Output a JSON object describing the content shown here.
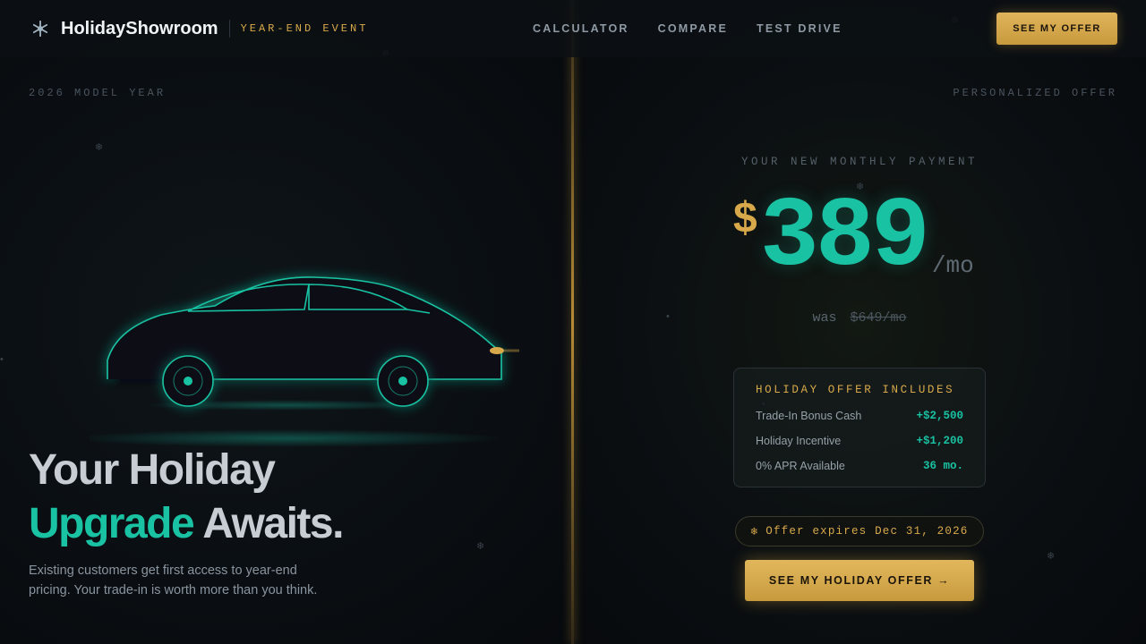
{
  "header": {
    "brand_name": "HolidayShowroom",
    "event_tag": "YEAR-END EVENT",
    "nav": [
      "CALCULATOR",
      "COMPARE",
      "TEST DRIVE"
    ],
    "cta_label": "SEE MY OFFER",
    "brand_icon": "snowflake-icon"
  },
  "left": {
    "tag": "2026 MODEL YEAR",
    "headline_line1": "Your Holiday",
    "headline_accent": "Upgrade",
    "headline_rest": " Awaits.",
    "subcopy": "Existing customers get first access to year-end pricing. Your trade-in is worth more than you think."
  },
  "right": {
    "tag": "PERSONALIZED OFFER",
    "payment_label": "YOUR NEW MONTHLY PAYMENT",
    "currency": "$",
    "amount": "389",
    "per": "/mo",
    "was_label": "was",
    "was_price": "$649/mo",
    "offer": {
      "title": "HOLIDAY OFFER INCLUDES",
      "rows": [
        {
          "label": "Trade-In Bonus Cash",
          "value": "+$2,500"
        },
        {
          "label": "Holiday Incentive",
          "value": "+$1,200"
        },
        {
          "label": "0% APR Available",
          "value": "36 mo."
        }
      ]
    },
    "expires_icon": "❄",
    "expires": "Offer expires Dec 31, 2026",
    "cta_label": "SEE MY HOLIDAY OFFER →"
  },
  "colors": {
    "accent_teal": "#19c2a3",
    "accent_gold": "#d8a94a",
    "background": "#0b0f14"
  }
}
